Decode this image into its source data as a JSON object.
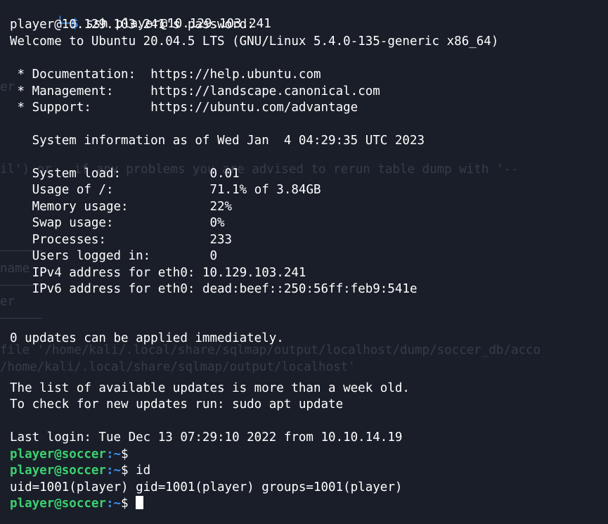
{
  "terminal": {
    "command_line": {
      "corner": "└─",
      "dollar": "$",
      "command": "ssh player@10.129.103.241"
    },
    "password_prompt": "player@10.129.103.241's password:",
    "welcome": "Welcome to Ubuntu 20.04.5 LTS (GNU/Linux 5.4.0-135-generic x86_64)",
    "links": [
      {
        "label": " * Documentation:  ",
        "url": "https://help.ubuntu.com"
      },
      {
        "label": " * Management:     ",
        "url": "https://landscape.canonical.com"
      },
      {
        "label": " * Support:        ",
        "url": "https://ubuntu.com/advantage"
      }
    ],
    "sysinfo_header": "   System information as of Wed Jan  4 04:29:35 UTC 2023",
    "sysinfo": [
      {
        "label": "   System load:            ",
        "value": "0.01"
      },
      {
        "label": "   Usage of /:             ",
        "value": "71.1% of 3.84GB"
      },
      {
        "label": "   Memory usage:           ",
        "value": "22%"
      },
      {
        "label": "   Swap usage:             ",
        "value": "0%"
      },
      {
        "label": "   Processes:              ",
        "value": "233"
      },
      {
        "label": "   Users logged in:        ",
        "value": "0"
      },
      {
        "label": "   IPv4 address for eth0: ",
        "value": "10.129.103.241"
      },
      {
        "label": "   IPv6 address for eth0: ",
        "value": "dead:beef::250:56ff:feb9:541e"
      }
    ],
    "updates": "0 updates can be applied immediately.",
    "list_old": "The list of available updates is more than a week old.",
    "check_updates": "To check for new updates run: sudo apt update",
    "last_login": "Last login: Tue Dec 13 07:29:10 2022 from 10.10.14.19",
    "prompts": [
      {
        "user": "player@soccer",
        "path": ":~",
        "tail": "$",
        "command": ""
      },
      {
        "user": "player@soccer",
        "path": ":~",
        "tail": "$",
        "command": " id"
      },
      {
        "user": "player@soccer",
        "path": ":~",
        "tail": "$",
        "command": ""
      }
    ],
    "id_output": "uid=1001(player) gid=1001(player) groups=1001(player)"
  },
  "ghost_background": {
    "line1": "er  -",
    "line2": "il') or   if any problems you are advised to rerun table dump with '--",
    "line3": "name",
    "line4": "er",
    "line5": "file '/home/kali/.local/share/sqlmap/output/localhost/dump/soccer_db/acco",
    "line6": "/home/kali/.local/share/sqlmap/output/localhost'"
  },
  "colors": {
    "background": "#1a1e29",
    "prompt_user": "#3bd16f",
    "prompt_path": "#3b8ff0",
    "text": "#ffffff"
  }
}
